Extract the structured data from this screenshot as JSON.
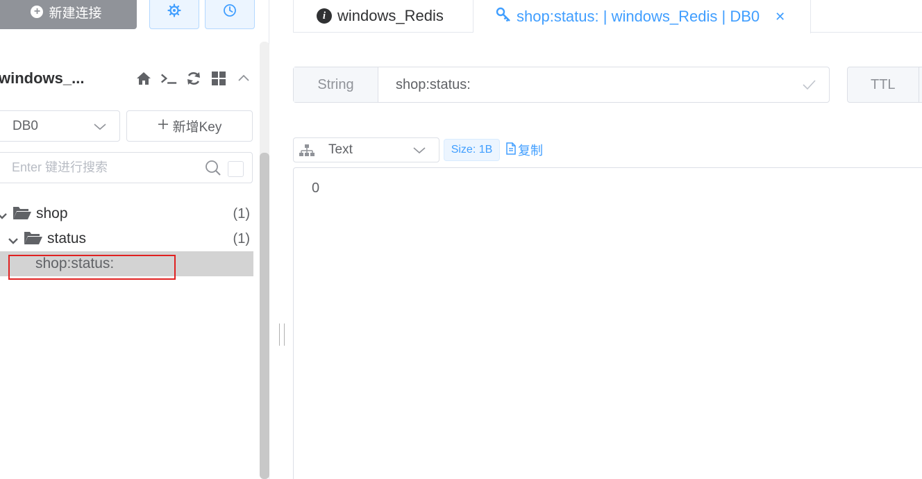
{
  "sidebar": {
    "new_connection_label": "新建连接",
    "connection_name": "windows_...",
    "db_select": "DB0",
    "add_key_label": "新增Key",
    "search_placeholder": "Enter 键进行搜索",
    "tree": [
      {
        "label": "shop",
        "count": "(1)",
        "type": "folder",
        "expanded": true,
        "depth": 0
      },
      {
        "label": "status",
        "count": "(1)",
        "type": "folder",
        "expanded": true,
        "depth": 1
      },
      {
        "label": "shop:status:",
        "count": "",
        "type": "key",
        "selected": true,
        "depth": 2
      }
    ]
  },
  "tabs": [
    {
      "label": "windows_Redis",
      "icon": "info-circle-icon"
    },
    {
      "label": "shop:status: | windows_Redis | DB0",
      "icon": "key-icon",
      "active": true
    }
  ],
  "key_view": {
    "type_label": "String",
    "key_name": "shop:status:",
    "ttl_label": "TTL",
    "format": "Text",
    "size_tag": "Size: 1B",
    "copy_label": "复制",
    "value": "0"
  },
  "colors": {
    "accent": "#409eff",
    "selected_row": "#d3d3d3",
    "highlight_border": "#e02020",
    "new_button": "#909399"
  }
}
